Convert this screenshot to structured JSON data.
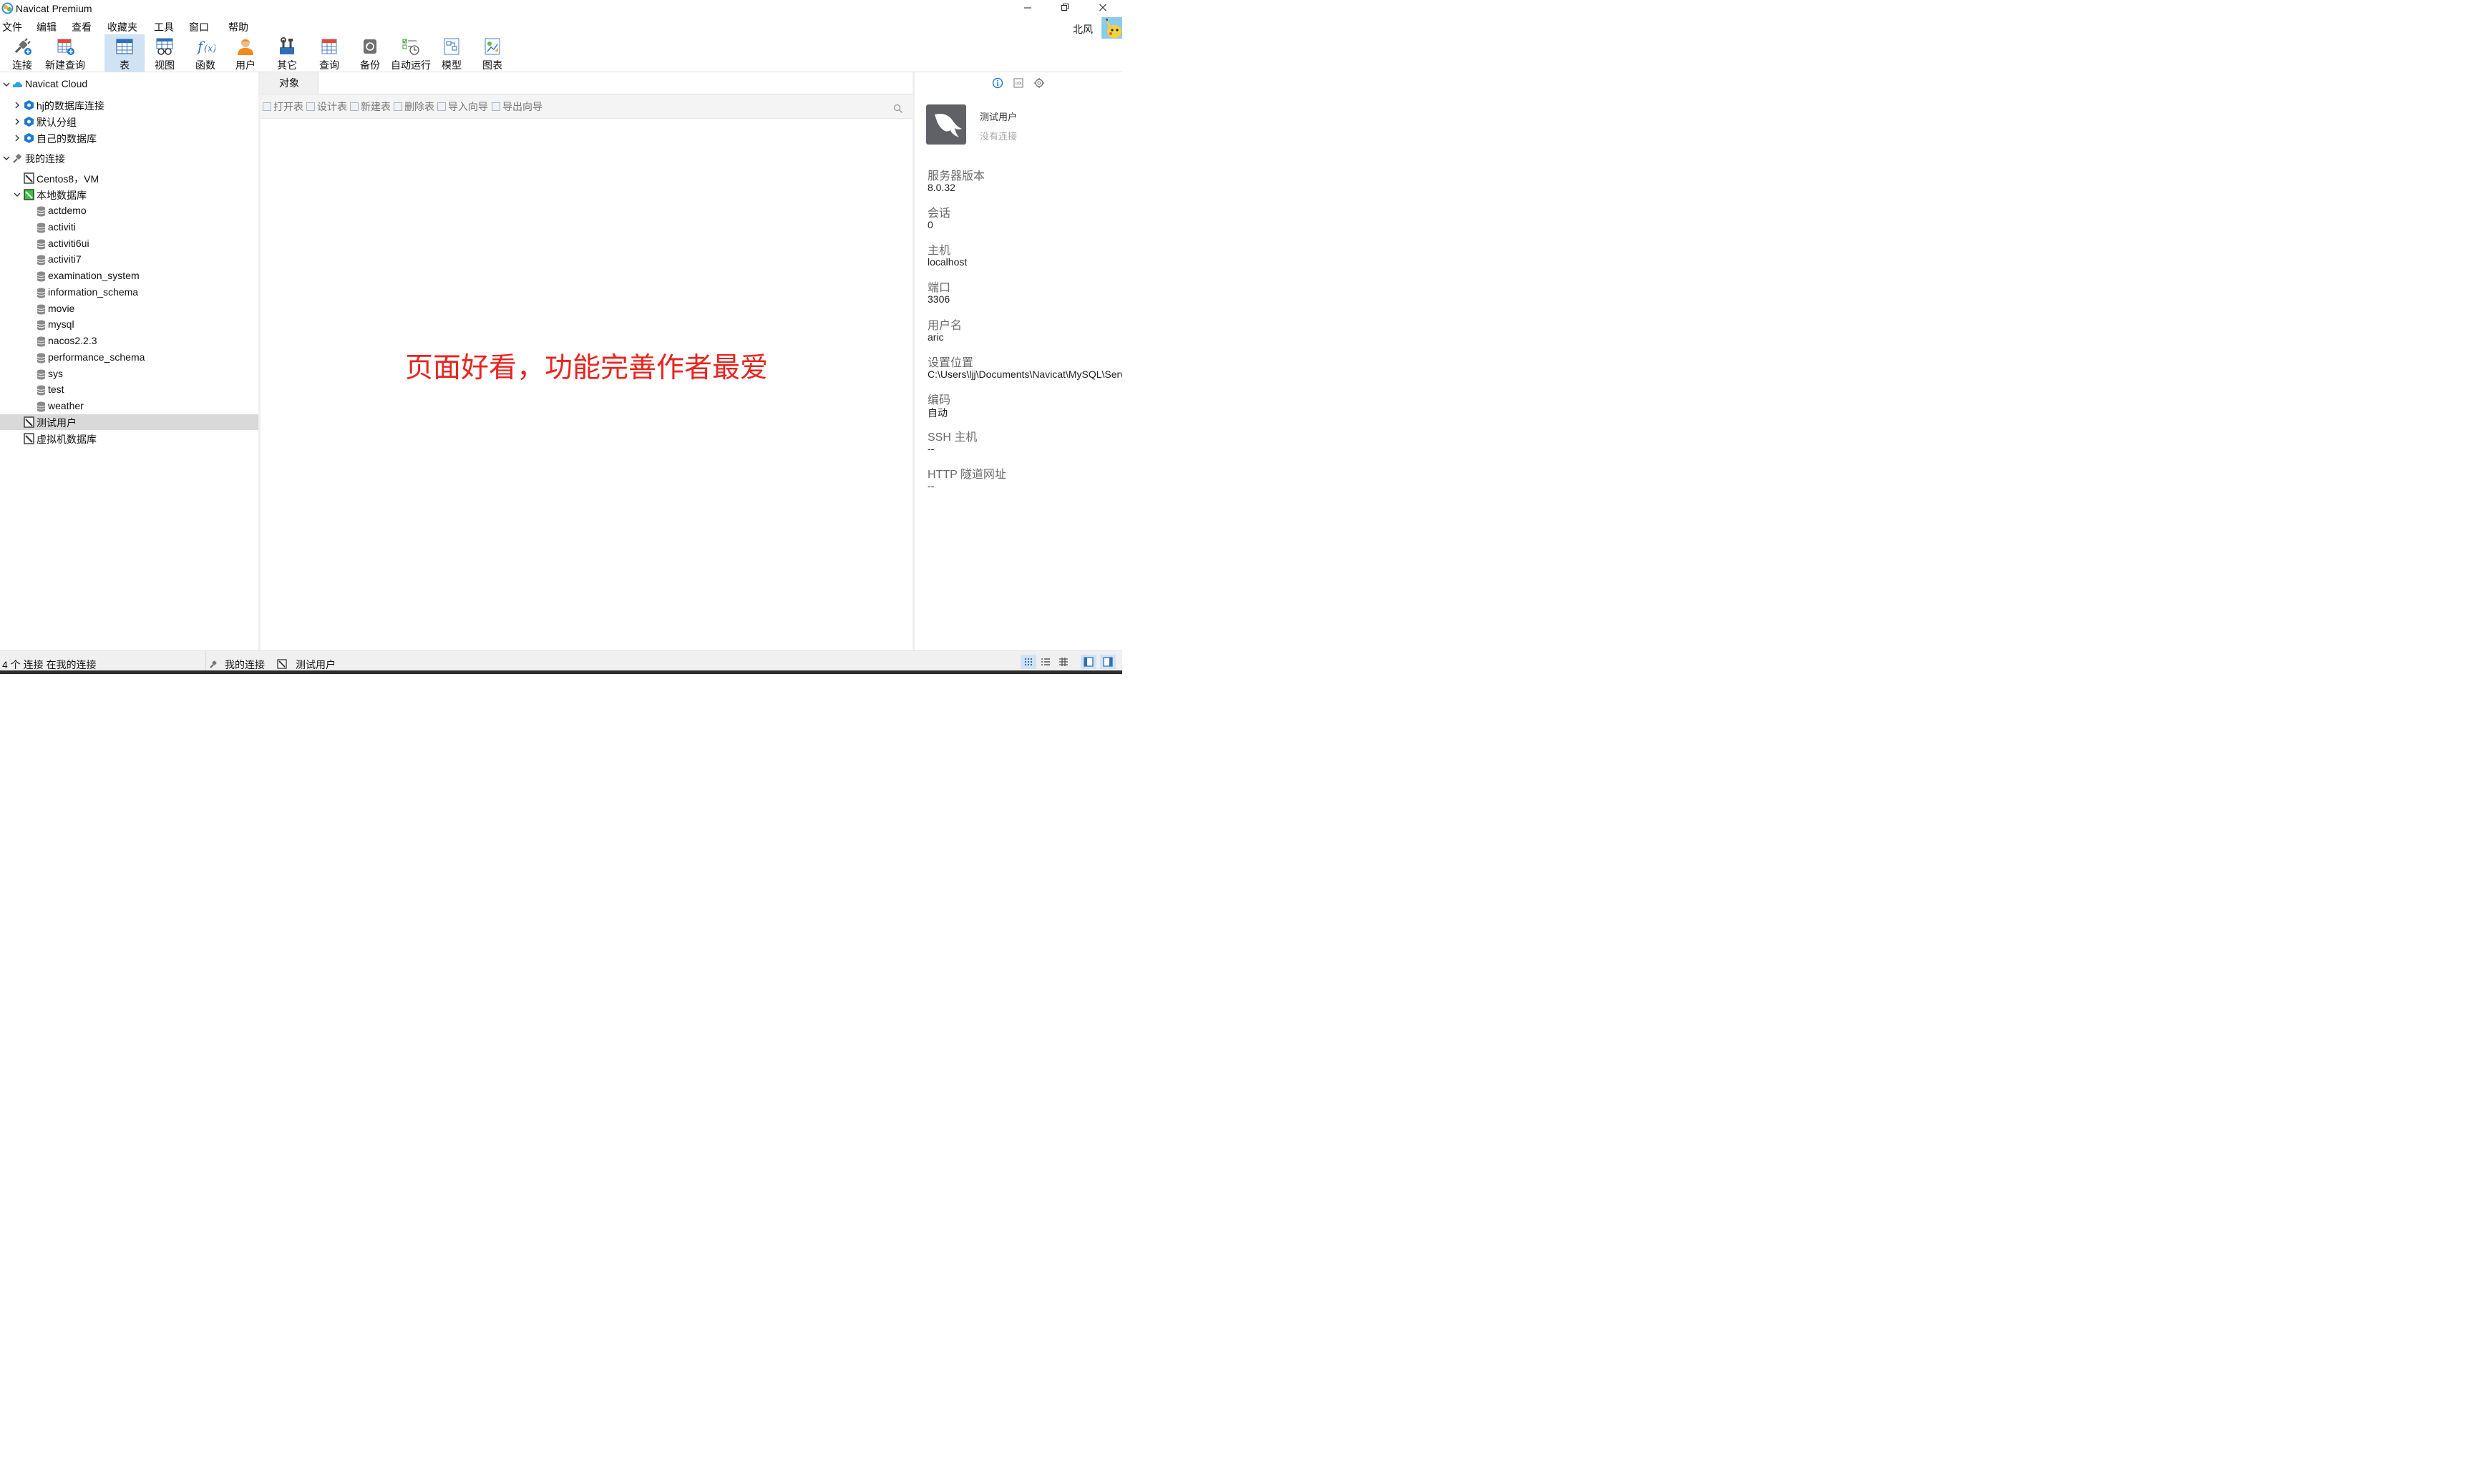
{
  "window": {
    "title": "Navicat Premium",
    "controls": [
      "minimize",
      "restore",
      "close"
    ]
  },
  "menu": [
    "文件",
    "编辑",
    "查看",
    "收藏夹",
    "工具",
    "窗口",
    "帮助"
  ],
  "user": {
    "name": "北风"
  },
  "toolbar": {
    "connect": "连接",
    "new_query": "新建查询",
    "table": "表",
    "view": "视图",
    "function": "函数",
    "user": "用户",
    "other": "其它",
    "query": "查询",
    "backup": "备份",
    "automation": "自动运行",
    "model": "模型",
    "chart": "图表",
    "active": "table"
  },
  "tree": {
    "cloud": {
      "label": "Navicat Cloud",
      "items": [
        "hj的数据库连接",
        "默认分组",
        "自己的数据库"
      ]
    },
    "my_connections": {
      "label": "我的连接",
      "centos": "Centos8，VM",
      "local": {
        "label": "本地数据库",
        "databases": [
          "actdemo",
          "activiti",
          "activiti6ui",
          "activiti7",
          "examination_system",
          "information_schema",
          "movie",
          "mysql",
          "nacos2.2.3",
          "performance_schema",
          "sys",
          "test",
          "weather"
        ]
      },
      "test_user": "测试用户",
      "vm_db": "虚拟机数据库",
      "selected": "测试用户"
    }
  },
  "center": {
    "tab": "对象",
    "actions": [
      "打开表",
      "设计表",
      "新建表",
      "删除表",
      "导入向导",
      "导出向导"
    ],
    "annotation": "页面好看，功能完善作者最爱"
  },
  "info": {
    "name": "测试用户",
    "status": "没有连接",
    "server_version_label": "服务器版本",
    "server_version": "8.0.32",
    "session_label": "会话",
    "session": "0",
    "host_label": "主机",
    "host": "localhost",
    "port_label": "端口",
    "port": "3306",
    "username_label": "用户名",
    "username": "aric",
    "settings_location_label": "设置位置",
    "settings_location": "C:\\Users\\ljj\\Documents\\Navicat\\MySQL\\Servers",
    "encoding_label": "编码",
    "encoding": "自动",
    "ssh_label": "SSH 主机",
    "ssh": "--",
    "http_label": "HTTP 隧道网址",
    "http": "--"
  },
  "status": {
    "count": "4 个 连接 在我的连接",
    "group": "我的连接",
    "connection": "测试用户"
  },
  "colors": {
    "accent_blue": "#1e78d4",
    "selection": "#d9d9d9",
    "active_button": "#cfe3f5",
    "annotation_red": "#e8241f",
    "connected_green": "#35c43a"
  }
}
